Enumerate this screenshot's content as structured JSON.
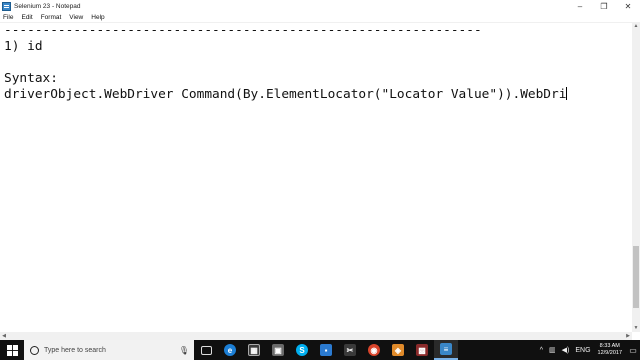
{
  "window": {
    "title": "Selenium 23 - Notepad",
    "controls": {
      "minimize": "–",
      "maximize": "❐",
      "close": "✕"
    }
  },
  "menu": [
    "File",
    "Edit",
    "Format",
    "View",
    "Help"
  ],
  "editor": {
    "lines": [
      "--------------------------------------------------------------",
      "1) id",
      "",
      "Syntax:",
      "driverObject.WebDriver Command(By.ElementLocator(\"Locator Value\")).WebDri"
    ]
  },
  "taskbar": {
    "search_placeholder": "Type here to search",
    "apps": [
      {
        "name": "task-view-icon",
        "glyph": "▭",
        "color": "#101010"
      },
      {
        "name": "edge-icon",
        "glyph": "e",
        "color": "#1c7fd6"
      },
      {
        "name": "calculator-icon",
        "glyph": "▦",
        "color": "#3b3b3b"
      },
      {
        "name": "photos-icon",
        "glyph": "▣",
        "color": "#6a6a6a"
      },
      {
        "name": "skype-icon",
        "glyph": "S",
        "color": "#00aff0"
      },
      {
        "name": "store-icon",
        "glyph": "▪",
        "color": "#2b7bd1"
      },
      {
        "name": "snipping-tool-icon",
        "glyph": "✂",
        "color": "#3a3a3a"
      },
      {
        "name": "chrome-icon",
        "glyph": "◉",
        "color": "#d9442b"
      },
      {
        "name": "package-icon",
        "glyph": "◈",
        "color": "#e08a2a"
      },
      {
        "name": "game-icon",
        "glyph": "▩",
        "color": "#8a2a2a"
      },
      {
        "name": "notepad-icon",
        "glyph": "≡",
        "color": "#3a87c8"
      }
    ],
    "tray": {
      "chevron": "^",
      "network": "▥",
      "volume": "◀)",
      "language": "ENG",
      "time": "8:33 AM",
      "date": "12/9/2017"
    }
  }
}
